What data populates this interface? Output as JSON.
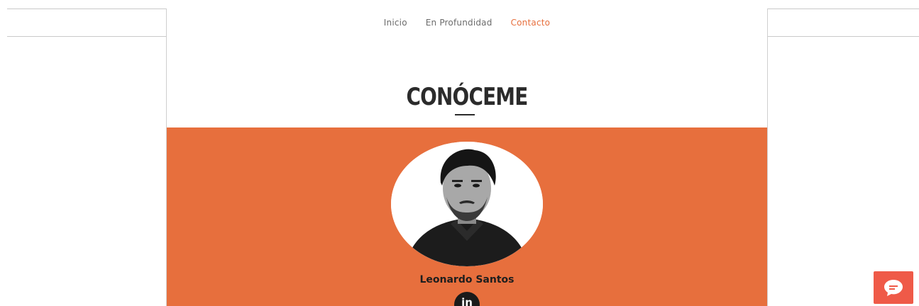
{
  "nav": {
    "items": [
      {
        "label": "Inicio",
        "active": false
      },
      {
        "label": "En Profundidad",
        "active": false
      },
      {
        "label": "Contacto",
        "active": true
      }
    ]
  },
  "about": {
    "heading": "CONÓCEME",
    "name": "Leonardo Santos",
    "social": {
      "icon": "linkedin-icon",
      "label": "in"
    }
  },
  "chat": {
    "icon": "chat-bubble-icon"
  },
  "colors": {
    "accent": "#e76f3d",
    "nav_active": "#e76f3d",
    "chat_button": "#ef5a48"
  }
}
